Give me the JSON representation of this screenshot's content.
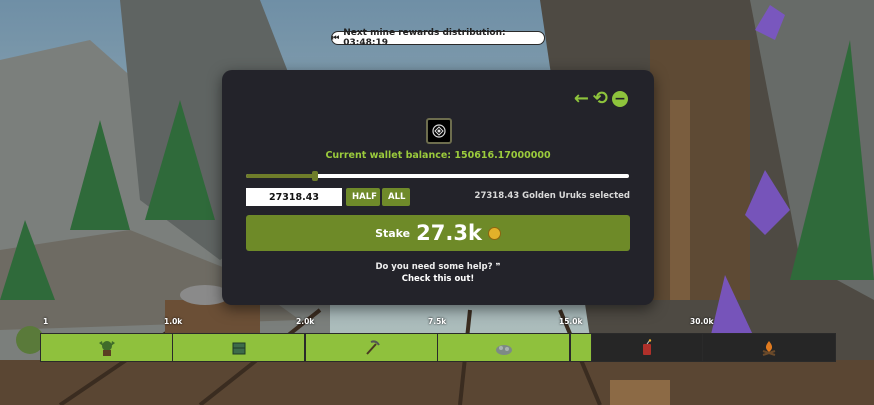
{
  "timer": {
    "prefix": "⏮",
    "text": "Next mine rewards distribution: 03:48:19"
  },
  "modal": {
    "back_icon": "←",
    "history_icon": "⟲",
    "minimize_icon": "−",
    "balance_text": "Current wallet balance: 150616.17000000",
    "slider_fraction": 0.18,
    "amount_value": "27318.43",
    "half_label": "HALF",
    "all_label": "ALL",
    "selected_text": "27318.43 Golden Uruks selected",
    "stake_label": "Stake",
    "stake_amount": "27.3k",
    "help_line1": "Do you need some help?",
    "help_quote": "❞",
    "help_line2": "Check this out!"
  },
  "tiers": [
    {
      "label": "1",
      "icon": "goblin-icon",
      "active": true
    },
    {
      "label": "1.0k",
      "icon": "crate-icon",
      "active": true
    },
    {
      "label": "2.0k",
      "icon": "pickaxe-icon",
      "active": true
    },
    {
      "label": "7.5k",
      "icon": "ore-icon",
      "active": true
    },
    {
      "label": "15.0k",
      "icon": "",
      "active": true
    },
    {
      "label": "",
      "icon": "dynamite-icon",
      "active": false
    },
    {
      "label": "30.0k",
      "icon": "campfire-icon",
      "active": false
    }
  ],
  "colors": {
    "accent": "#8fc13d",
    "button": "#6e8a28",
    "modal": "#23232a"
  }
}
